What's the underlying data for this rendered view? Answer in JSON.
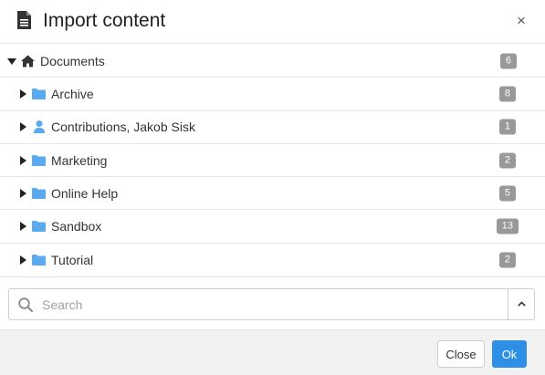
{
  "dialog": {
    "title": "Import content",
    "title_icon": "document-icon",
    "close_icon": "close-icon",
    "close_symbol": "×"
  },
  "tree": {
    "root": {
      "label": "Documents",
      "icon": "home-icon",
      "count": "6",
      "expanded": true
    },
    "items": [
      {
        "label": "Archive",
        "icon": "folder-icon",
        "count": "8"
      },
      {
        "label": "Contributions, Jakob Sisk",
        "icon": "user-icon",
        "count": "1"
      },
      {
        "label": "Marketing",
        "icon": "folder-icon",
        "count": "2"
      },
      {
        "label": "Online Help",
        "icon": "folder-icon",
        "count": "5"
      },
      {
        "label": "Sandbox",
        "icon": "folder-icon",
        "count": "13"
      },
      {
        "label": "Tutorial",
        "icon": "folder-icon",
        "count": "2"
      }
    ]
  },
  "search": {
    "placeholder": "Search",
    "value": ""
  },
  "footer": {
    "close_label": "Close",
    "ok_label": "Ok"
  },
  "colors": {
    "accent": "#2d8fe6",
    "folder": "#5aaaf0",
    "badge": "#999999"
  }
}
